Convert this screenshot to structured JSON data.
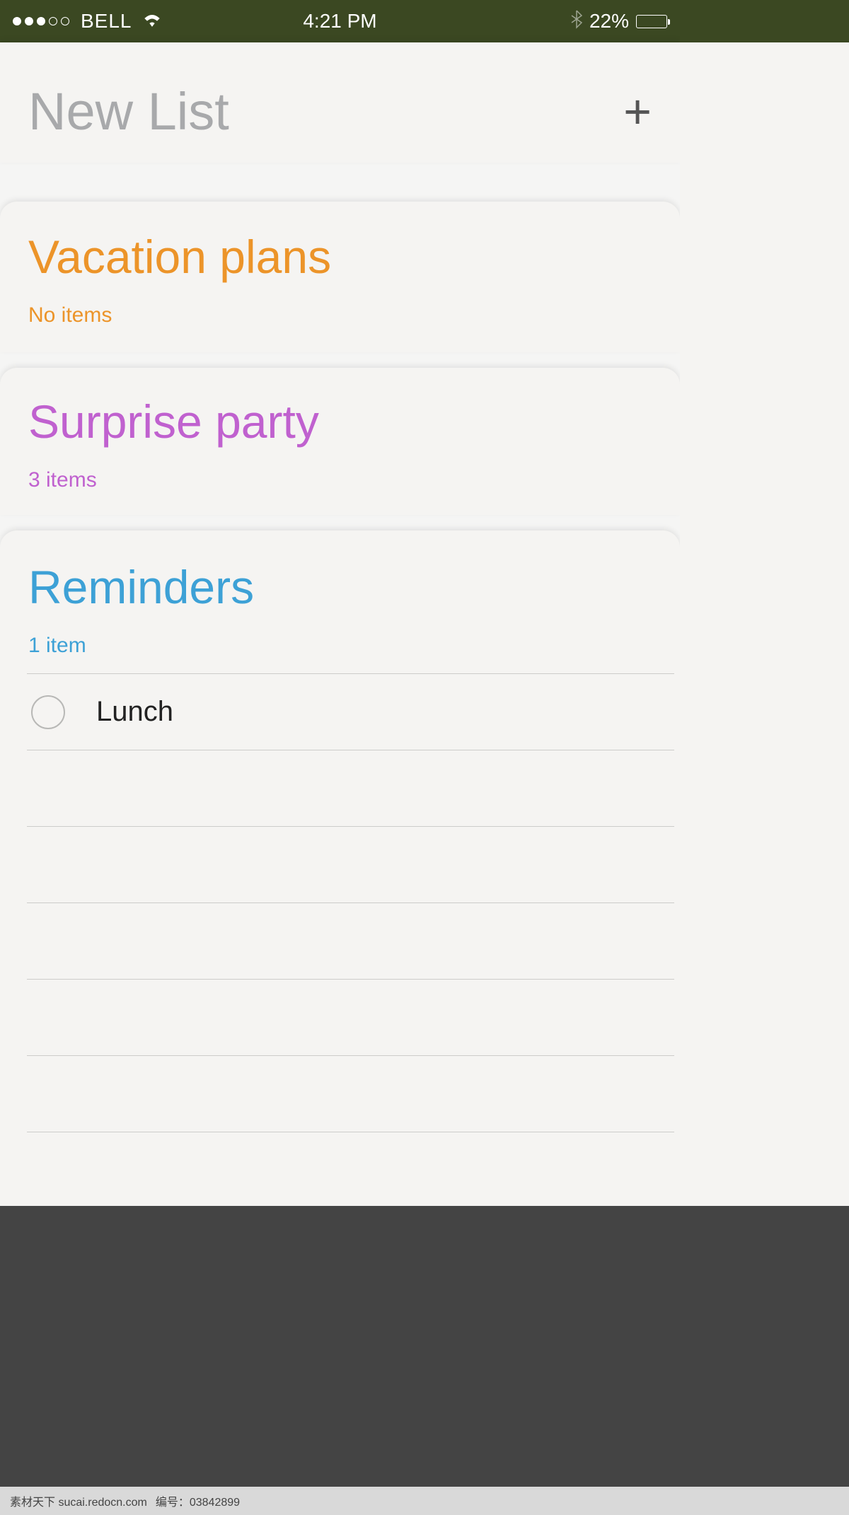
{
  "statusBar": {
    "carrier": "BELL",
    "time": "4:21 PM",
    "batteryPercent": "22%"
  },
  "newList": {
    "title": "New List"
  },
  "lists": {
    "vacation": {
      "title": "Vacation plans",
      "subtitle": "No items"
    },
    "surprise": {
      "title": "Surprise party",
      "subtitle": "3 items"
    },
    "reminders": {
      "title": "Reminders",
      "subtitle": "1 item",
      "items": [
        {
          "text": "Lunch",
          "done": false
        }
      ]
    }
  },
  "footer": {
    "siteText": "素材天下 sucai.redocn.com",
    "idText": "编号：03842899"
  }
}
